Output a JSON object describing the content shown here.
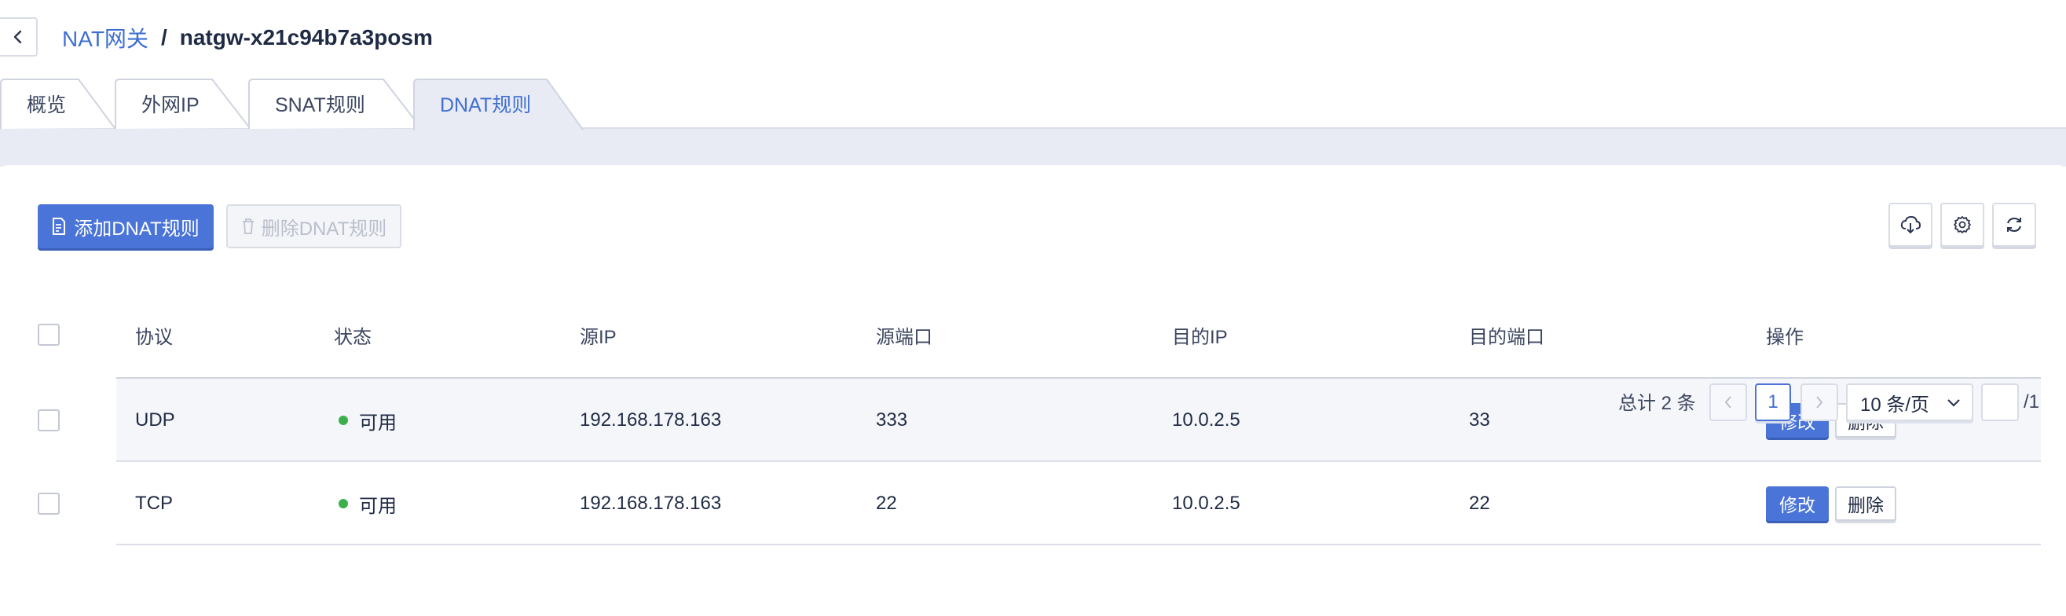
{
  "header": {
    "breadcrumb_parent": "NAT网关",
    "breadcrumb_separator": "/",
    "breadcrumb_current": "natgw-x21c94b7a3posm"
  },
  "tabs": [
    {
      "label": "概览",
      "active": false
    },
    {
      "label": "外网IP",
      "active": false
    },
    {
      "label": "SNAT规则",
      "active": false
    },
    {
      "label": "DNAT规则",
      "active": true
    }
  ],
  "toolbar": {
    "add_label": "添加DNAT规则",
    "delete_label": "删除DNAT规则",
    "icons": [
      "cloud-download-icon",
      "gear-icon",
      "refresh-icon"
    ]
  },
  "table": {
    "columns": [
      "协议",
      "状态",
      "源IP",
      "源端口",
      "目的IP",
      "目的端口",
      "操作"
    ],
    "rows": [
      {
        "protocol": "UDP",
        "status": "可用",
        "src_ip": "192.168.178.163",
        "src_port": "333",
        "dst_ip": "10.0.2.5",
        "dst_port": "33",
        "edit": "修改",
        "delete": "删除"
      },
      {
        "protocol": "TCP",
        "status": "可用",
        "src_ip": "192.168.178.163",
        "src_port": "22",
        "dst_ip": "10.0.2.5",
        "dst_port": "22",
        "edit": "修改",
        "delete": "删除"
      }
    ]
  },
  "pagination": {
    "total_text": "总计 2 条",
    "current_page": "1",
    "page_size": "10 条/页",
    "jump_value": "",
    "total_pages": "/1"
  },
  "colors": {
    "accent": "#4a74d8",
    "link": "#3f6fd1",
    "status_ok": "#3bb04a",
    "band": "#e8ebf4"
  }
}
